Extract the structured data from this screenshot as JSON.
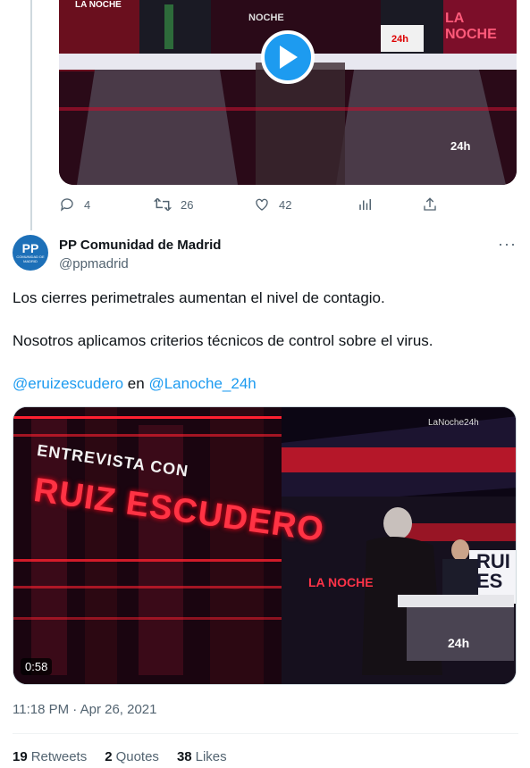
{
  "previous_tweet": {
    "play_icon": "play-icon",
    "replies": "4",
    "retweets": "26",
    "likes": "42",
    "video_overlay_labels": [
      "LA NOCHE",
      "NOCHE",
      "24h",
      "LA NOCHE",
      "24h"
    ]
  },
  "tweet": {
    "author_name": "PP Comunidad de Madrid",
    "author_handle": "@ppmadrid",
    "avatar_text": "PP",
    "avatar_sub": "COMUNIDAD DE MADRID",
    "line1": "Los cierres perimetrales aumentan el nivel de contagio.",
    "line2": "Nosotros aplicamos criterios técnicos de control sobre el virus.",
    "mention1": "@eruizescudero",
    "connector": "en",
    "mention2": "@Lanoche_24h",
    "video": {
      "duration": "0:58",
      "title_small": "ENTREVISTA CON",
      "title_big": "RUIZ ESCUDERO",
      "channel_tag": "LaNoche24h",
      "side_label": "LA NOCHE",
      "badge": "24h",
      "screen_text": "RUI ES"
    },
    "timestamp": "11:18 PM · Apr 26, 2021",
    "stats": {
      "retweets_count": "19",
      "retweets_label": "Retweets",
      "quotes_count": "2",
      "quotes_label": "Quotes",
      "likes_count": "38",
      "likes_label": "Likes"
    }
  },
  "colors": {
    "link": "#1d9bf0",
    "muted": "#536471",
    "play": "#1d9bf0"
  }
}
